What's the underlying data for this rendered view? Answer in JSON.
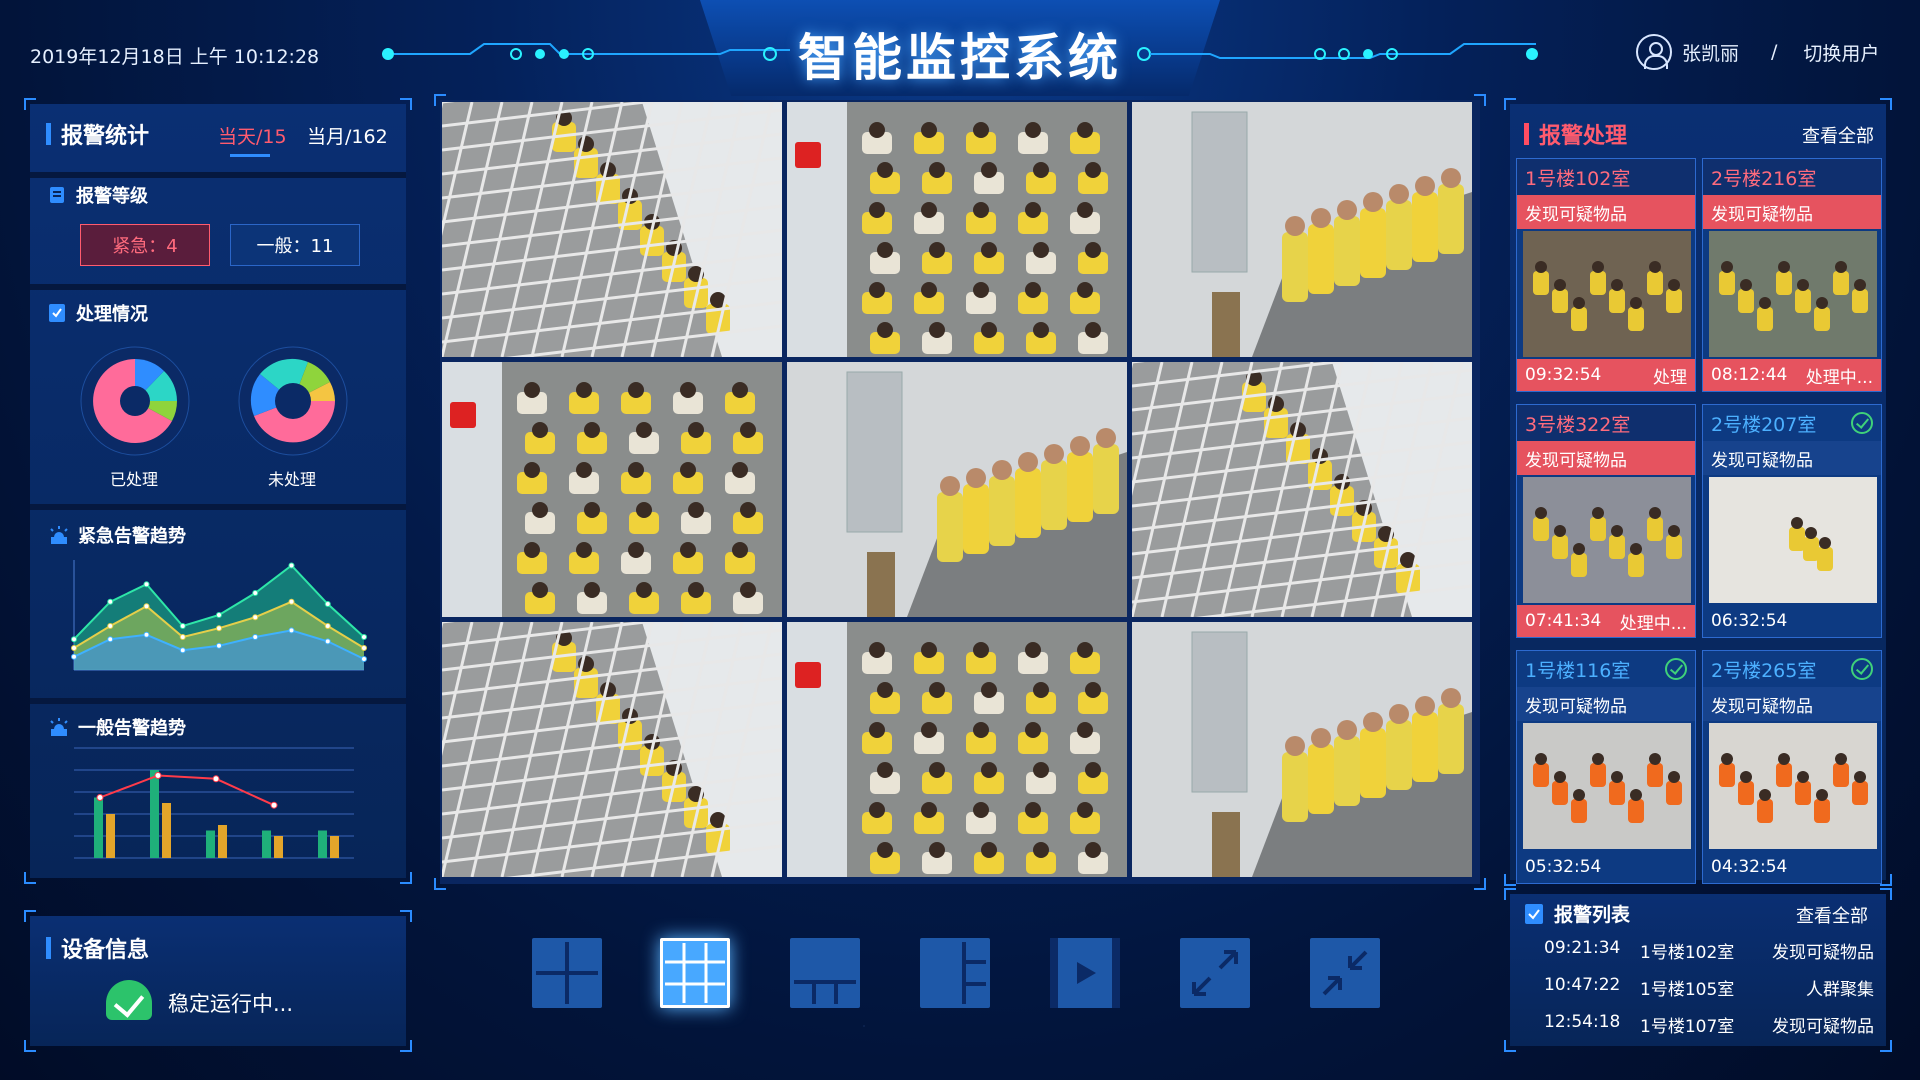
{
  "header": {
    "datetime": "2019年12月18日  上午 10:12:28",
    "title": "智能监控系统",
    "user_name": "张凯丽",
    "separator": "/",
    "switch_user": "切换用户"
  },
  "alarm_stats": {
    "title": "报警统计",
    "tab_today": "当天/15",
    "tab_month": "当月/162",
    "level_title": "报警等级",
    "urgent_label": "紧急：4",
    "normal_label": "一般：11",
    "process_title": "处理情况",
    "processed_label": "已处理",
    "unprocessed_label": "未处理",
    "urgent_trend_title": "紧急告警趋势",
    "normal_trend_title": "一般告警趋势"
  },
  "device": {
    "title": "设备信息",
    "status": "稳定运行中..."
  },
  "layout_buttons": [
    {
      "name": "layout-2x2-button",
      "active": false
    },
    {
      "name": "layout-3x3-button",
      "active": true
    },
    {
      "name": "layout-1plus3-button",
      "active": false
    },
    {
      "name": "layout-side-split-button",
      "active": false
    },
    {
      "name": "play-button",
      "active": false
    },
    {
      "name": "fullscreen-button",
      "active": false
    },
    {
      "name": "exit-fullscreen-button",
      "active": false
    }
  ],
  "alarm_handle": {
    "title": "报警处理",
    "view_all": "查看全部",
    "cards": [
      {
        "room": "1号楼102室",
        "desc": "发现可疑物品",
        "time": "09:32:54",
        "status": "处理",
        "red": true,
        "done": false,
        "scene": "crowd-yellow"
      },
      {
        "room": "2号楼216室",
        "desc": "发现可疑物品",
        "time": "08:12:44",
        "status": "处理中...",
        "red": true,
        "done": false,
        "scene": "crowd-yellow-2"
      },
      {
        "room": "3号楼322室",
        "desc": "发现可疑物品",
        "time": "07:41:34",
        "status": "处理中...",
        "red": true,
        "done": false,
        "scene": "room-floor"
      },
      {
        "room": "2号楼207室",
        "desc": "发现可疑物品",
        "time": "06:32:54",
        "status": "",
        "red": false,
        "done": true,
        "scene": "corridor"
      },
      {
        "room": "1号楼116室",
        "desc": "发现可疑物品",
        "time": "05:32:54",
        "status": "",
        "red": false,
        "done": true,
        "scene": "orange-row"
      },
      {
        "room": "2号楼265室",
        "desc": "发现可疑物品",
        "time": "04:32:54",
        "status": "",
        "red": false,
        "done": true,
        "scene": "orange-corridor"
      }
    ]
  },
  "alarm_list": {
    "title": "报警列表",
    "view_all": "查看全部",
    "rows": [
      {
        "time": "09:21:34",
        "room": "1号楼102室",
        "type": "发现可疑物品"
      },
      {
        "time": "10:47:22",
        "room": "1号楼105室",
        "type": "人群聚集"
      },
      {
        "time": "12:54:18",
        "room": "1号楼107室",
        "type": "发现可疑物品"
      }
    ]
  },
  "cameras": [
    {
      "scene": "cage"
    },
    {
      "scene": "crowd"
    },
    {
      "scene": "bench"
    },
    {
      "scene": "crowd"
    },
    {
      "scene": "bench"
    },
    {
      "scene": "cage"
    },
    {
      "scene": "cage"
    },
    {
      "scene": "crowd"
    },
    {
      "scene": "bench"
    }
  ],
  "colors": {
    "accent": "#2f8dff",
    "alert": "#ff5b6e",
    "ok": "#2cc36b",
    "donut": [
      "#ff6b9a",
      "#2f8dff",
      "#2cd6c6",
      "#8fd43c",
      "#f4c542"
    ]
  },
  "chart_data": [
    {
      "type": "area",
      "series": [
        {
          "values": [
            28,
            62,
            78,
            40,
            50,
            70,
            95,
            60,
            30
          ]
        },
        {
          "values": [
            20,
            40,
            58,
            30,
            38,
            48,
            62,
            40,
            20
          ]
        },
        {
          "values": [
            12,
            28,
            32,
            18,
            22,
            30,
            36,
            26,
            10
          ]
        }
      ],
      "ylim": [
        0,
        100
      ]
    },
    {
      "type": "bar",
      "series": [
        {
          "values": [
            55,
            80,
            25,
            25,
            25
          ]
        },
        {
          "values": [
            40,
            50,
            30,
            20,
            20
          ]
        },
        {
          "values": [
            55,
            75,
            72,
            48
          ]
        }
      ],
      "ylim": [
        0,
        100
      ]
    }
  ]
}
